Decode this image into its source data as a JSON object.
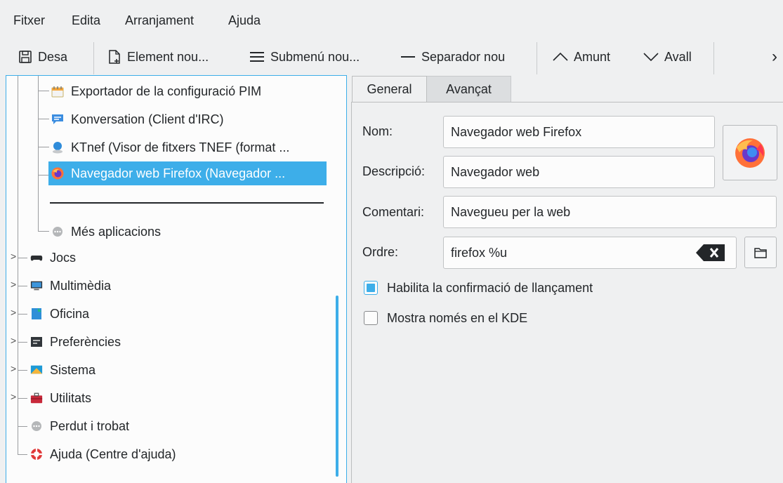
{
  "menubar": {
    "items": [
      "Fitxer",
      "Edita",
      "Arranjament",
      "Ajuda"
    ]
  },
  "toolbar": {
    "save": "Desa",
    "new_item": "Element nou...",
    "new_submenu": "Submenú nou...",
    "new_separator": "Separador nou",
    "move_up": "Amunt",
    "move_down": "Avall",
    "more": "›"
  },
  "tree": {
    "children": [
      {
        "label": "Exportador de la configuració PIM",
        "icon": "pim-settings-icon"
      },
      {
        "label": "Konversation (Client d'IRC)",
        "icon": "chat-icon"
      },
      {
        "label": "KTnef (Visor de fitxers TNEF (format ...",
        "icon": "tnef-icon"
      },
      {
        "label": "Navegador web Firefox (Navegador ...",
        "icon": "firefox-icon",
        "selected": true
      },
      {
        "label": "Més aplicacions",
        "icon": "more-apps-icon"
      }
    ],
    "categories": [
      {
        "label": "Jocs",
        "icon": "gamepad-icon",
        "expandable": true
      },
      {
        "label": "Multimèdia",
        "icon": "multimedia-icon",
        "expandable": true
      },
      {
        "label": "Oficina",
        "icon": "office-icon",
        "expandable": true
      },
      {
        "label": "Preferències",
        "icon": "preferences-icon",
        "expandable": true
      },
      {
        "label": "Sistema",
        "icon": "system-icon",
        "expandable": true
      },
      {
        "label": "Utilitats",
        "icon": "utilities-icon",
        "expandable": true
      },
      {
        "label": "Perdut i trobat",
        "icon": "lost-found-icon",
        "expandable": false
      },
      {
        "label": "Ajuda (Centre d'ajuda)",
        "icon": "help-center-icon",
        "expandable": false
      }
    ],
    "expander_glyph": ">"
  },
  "tabs": {
    "general": "General",
    "advanced": "Avançat",
    "active": "general"
  },
  "form": {
    "name_label": "Nom:",
    "name_value": "Navegador web Firefox",
    "description_label": "Descripció:",
    "description_value": "Navegador web",
    "comment_label": "Comentari:",
    "comment_value": "Navegueu per la web",
    "command_label": "Ordre:",
    "command_value": "firefox %u",
    "launch_feedback_label": "Habilita la confirmació de llançament",
    "launch_feedback_checked": true,
    "kde_only_label": "Mostra només en el KDE",
    "kde_only_checked": false
  },
  "colors": {
    "selection": "#3daee9",
    "window_bg": "#eff0f1",
    "view_bg": "#fcfcfc",
    "firefox_orange": "#ff7139",
    "firefox_purple": "#6a38c9"
  }
}
